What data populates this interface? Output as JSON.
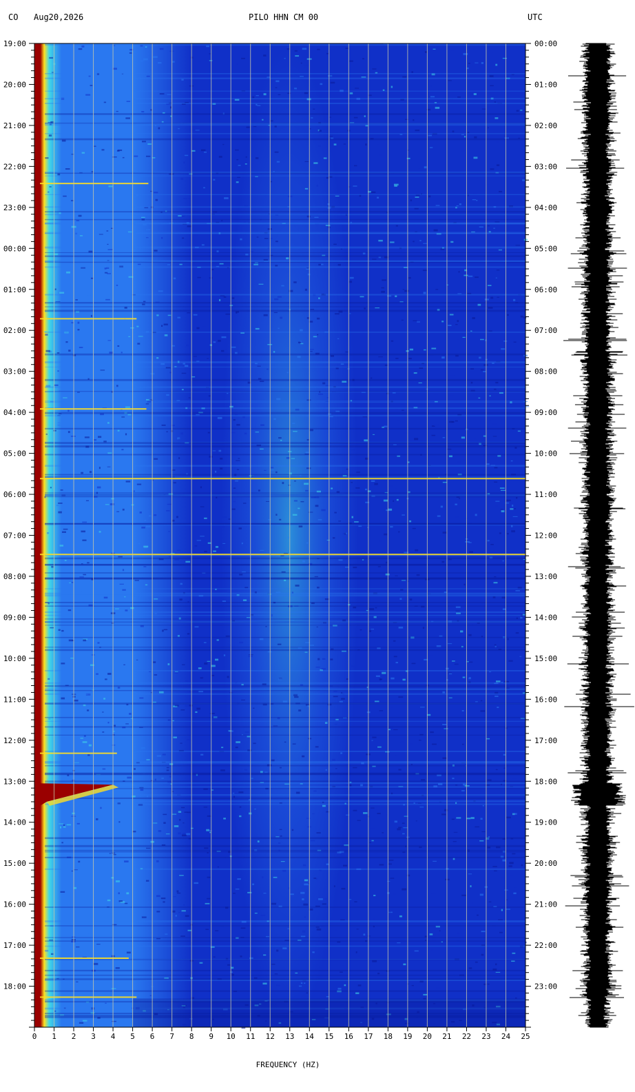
{
  "header": {
    "network": "CO",
    "date": "Aug20,2026",
    "channel": "PILO HHN CM 00",
    "timezone": "UTC"
  },
  "chart_data": {
    "type": "heatmap",
    "title": "PILO HHN CM 00",
    "xlabel": "FREQUENCY (HZ)",
    "xlim": [
      0,
      25
    ],
    "x_ticks": [
      0,
      1,
      2,
      3,
      4,
      5,
      6,
      7,
      8,
      9,
      10,
      11,
      12,
      13,
      14,
      15,
      16,
      17,
      18,
      19,
      20,
      21,
      22,
      23,
      24,
      25
    ],
    "y_left_ticks": [
      "19:00",
      "20:00",
      "21:00",
      "22:00",
      "23:00",
      "00:00",
      "01:00",
      "02:00",
      "03:00",
      "04:00",
      "05:00",
      "06:00",
      "07:00",
      "08:00",
      "09:00",
      "10:00",
      "11:00",
      "12:00",
      "13:00",
      "14:00",
      "15:00",
      "16:00",
      "17:00",
      "18:00"
    ],
    "y_right_ticks": [
      "00:00",
      "01:00",
      "02:00",
      "03:00",
      "04:00",
      "05:00",
      "06:00",
      "07:00",
      "08:00",
      "09:00",
      "10:00",
      "11:00",
      "12:00",
      "13:00",
      "14:00",
      "15:00",
      "16:00",
      "17:00",
      "18:00",
      "19:00",
      "20:00",
      "21:00",
      "22:00",
      "23:00"
    ],
    "y_hours": 24,
    "colors": {
      "background": "#1030c8",
      "low": "#0a1a9a",
      "mid": "#2a78f0",
      "high": "#40d8e8",
      "peak": "#ffe020",
      "max": "#9a0000",
      "grid": "#c8c8a8",
      "trace": "#000000"
    },
    "events": [
      {
        "hour": 3.4,
        "fmax": 5.8
      },
      {
        "hour": 6.7,
        "fmax": 5.2
      },
      {
        "hour": 8.9,
        "fmax": 5.7
      },
      {
        "hour": 10.6,
        "fmax": 25
      },
      {
        "hour": 12.45,
        "fmax": 25
      },
      {
        "hour": 17.3,
        "fmax": 4.2
      },
      {
        "hour": 22.3,
        "fmax": 4.8
      },
      {
        "hour": 23.25,
        "fmax": 5.2
      }
    ],
    "large_event": {
      "start_hour": 18.05,
      "end_hour": 18.6,
      "fmax": 4.0
    }
  }
}
